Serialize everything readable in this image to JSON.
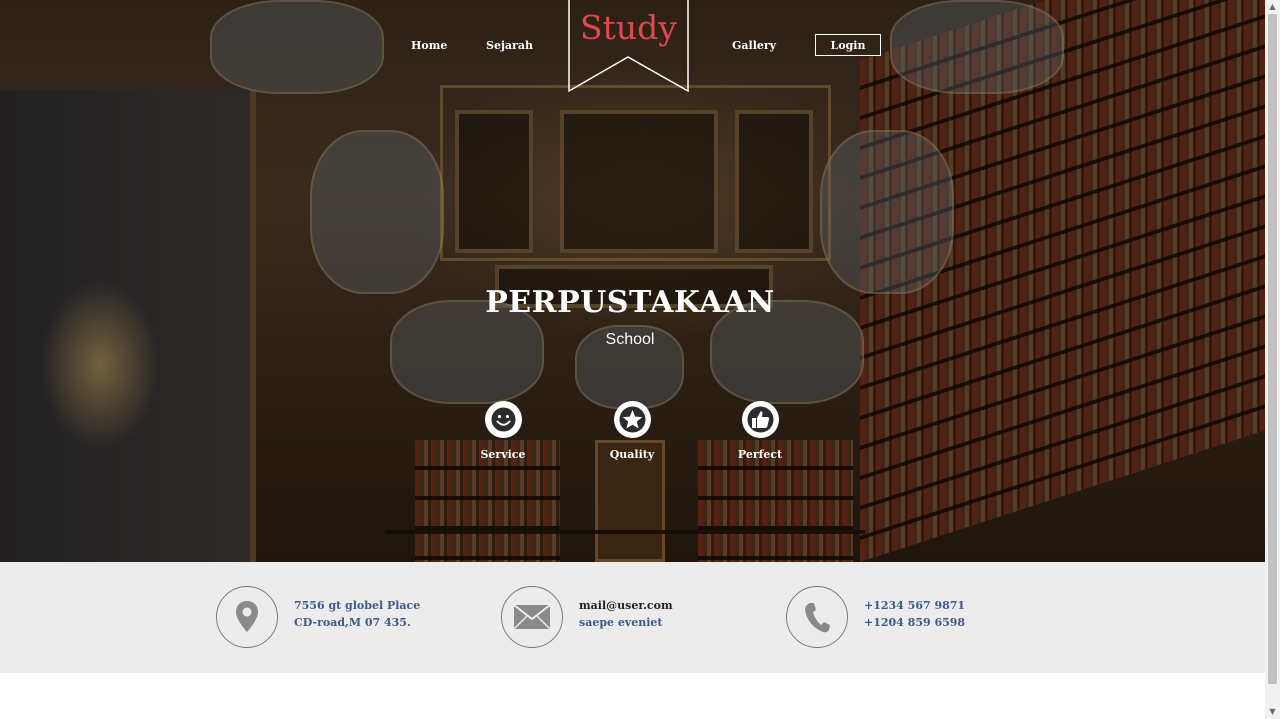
{
  "nav": {
    "logo": "Study",
    "links": [
      "Home",
      "Sejarah",
      "Gallery"
    ],
    "login": "Login"
  },
  "hero": {
    "title": "PERPUSTAKAAN",
    "subtitle": "School",
    "features": [
      {
        "icon": "smile-icon",
        "label": "Service"
      },
      {
        "icon": "star-icon",
        "label": "Quality"
      },
      {
        "icon": "thumbs-up-icon",
        "label": "Perfect"
      }
    ]
  },
  "contact": {
    "address": {
      "icon": "location-pin-icon",
      "line1": "7556 gt globel Place",
      "line2": "CD-road,M 07 435."
    },
    "email": {
      "icon": "envelope-icon",
      "line1": "mail@user.com",
      "line2": "saepe eveniet"
    },
    "phone": {
      "icon": "phone-icon",
      "line1": "+1234 567 9871",
      "line2": "+1204 859 6598"
    }
  },
  "colors": {
    "logo": "#e0484d",
    "contact_bg": "#ececec",
    "contact_text": "#3c5a8a"
  }
}
